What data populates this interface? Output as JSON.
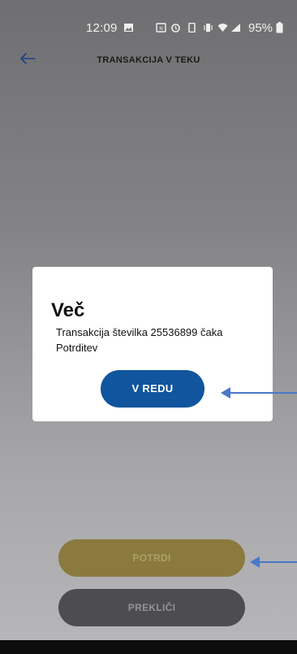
{
  "status_bar": {
    "time": "12:09",
    "battery": "95%",
    "icons": [
      "image-icon",
      "nfc-icon",
      "alarm-icon",
      "phone-icon",
      "vibrate-icon",
      "wifi-icon",
      "signal-icon",
      "battery-icon"
    ]
  },
  "header": {
    "title": "TRANSAKCIJA V TEKU",
    "back_icon": "back-arrow-icon"
  },
  "dialog": {
    "title": "Več",
    "message": "Transakcija številka 25536899 čaka Potrditev",
    "ok_label": "V REDU"
  },
  "actions": {
    "confirm_label": "POTRDI",
    "cancel_label": "PREKLIČI"
  },
  "colors": {
    "primary_blue": "#10559d",
    "confirm_gold": "#8a7a3e",
    "cancel_gray": "#4d4d4f",
    "annotation_arrow": "#4a78c8"
  }
}
